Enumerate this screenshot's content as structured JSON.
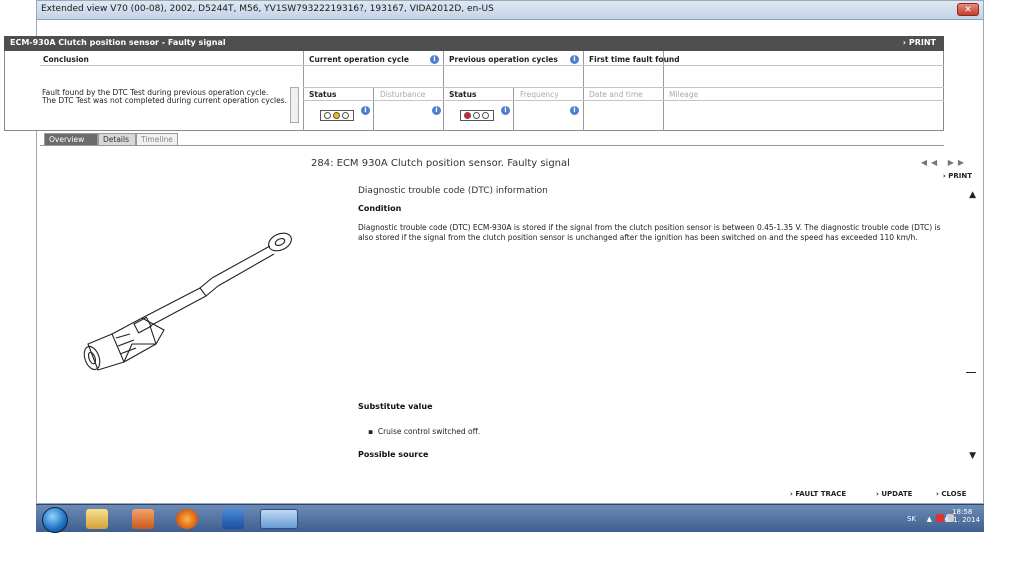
{
  "window": {
    "title": "Extended view  V70 (00-08), 2002, D5244T, M56, YV1SW79322219316?, 193167, VIDA2012D, en-US",
    "close_glyph": "✕"
  },
  "fault_panel": {
    "title": "ECM-930A Clutch position sensor - Faulty signal",
    "print": "PRINT",
    "headers": {
      "conclusion": "Conclusion",
      "current": "Current operation cycle",
      "previous": "Previous operation cycles",
      "first_found": "First time fault found"
    },
    "subheaders": {
      "status1": "Status",
      "disturbance": "Disturbance",
      "status2": "Status",
      "frequency": "Frequency",
      "date_time": "Date and time",
      "mileage": "Mileage"
    },
    "conclusion_lines": [
      "Fault found by the DTC Test during previous operation cycle.",
      "The DTC Test was not completed during current operation cycles."
    ],
    "info_glyph": "i"
  },
  "tabs": [
    "Overview",
    "Details",
    "Timeline"
  ],
  "document": {
    "title": "284: ECM 930A Clutch position sensor. Faulty signal",
    "nav_arrows": "◀◀ ▶▶",
    "print": "PRINT",
    "section1_title": "Diagnostic trouble code (DTC) information",
    "condition_heading": "Condition",
    "condition_text": "Diagnostic trouble code (DTC) ECM-930A is stored if the signal from the clutch position sensor is between 0.45-1.35 V. The diagnostic trouble code (DTC) is also stored if the signal from the clutch position sensor is unchanged after the ignition has been switched on and the speed has exceeded 110 km/h.",
    "substitute_heading": "Substitute value",
    "substitute_item": "Cruise control switched off.",
    "possible_heading": "Possible source"
  },
  "bottom_actions": {
    "fault_trace": "FAULT TRACE",
    "update": "UPDATE",
    "close": "CLOSE"
  },
  "taskbar": {
    "lang": "SK",
    "time": "18:58",
    "date": "6. 1. 2014"
  },
  "colors": {
    "header_bar": "#4f4f4f",
    "status_yellow": "#f2c200",
    "status_red": "#e02020",
    "taskbar": "#4e6f9e"
  }
}
